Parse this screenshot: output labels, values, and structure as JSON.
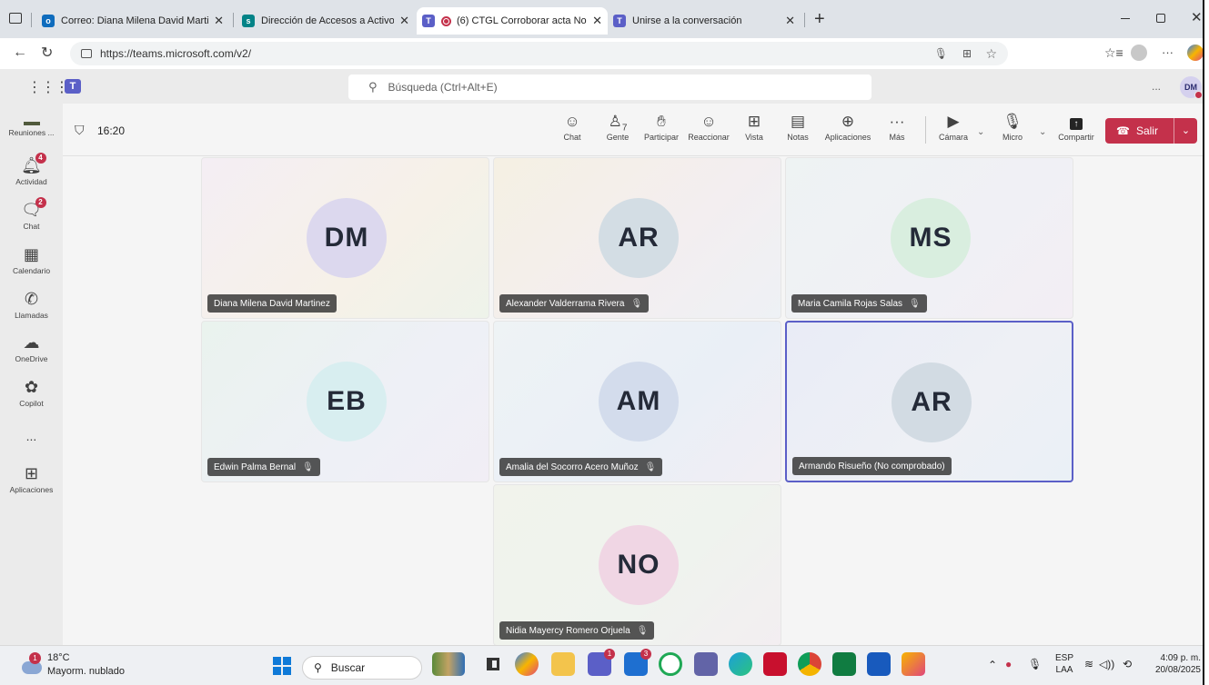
{
  "browser": {
    "tabs": [
      {
        "title": "Correo: Diana Milena David Marti",
        "icon_color": "#0f6cbd",
        "active": false
      },
      {
        "title": "Dirección de Accesos a Activos P",
        "icon_color": "#038387",
        "active": false
      },
      {
        "title": "(6) CTGL Corroborar acta No",
        "icon_color": "#5b5fc7",
        "active": true
      },
      {
        "title": "Unirse a la conversación",
        "icon_color": "#5b5fc7",
        "active": false
      }
    ],
    "url": "https://teams.microsoft.com/v2/",
    "new_tab": "+",
    "profile_initials": "DM"
  },
  "teams": {
    "search_placeholder": "Búsqueda (Ctrl+Alt+E)",
    "profile_initials": "DM",
    "more": "..."
  },
  "rail": [
    {
      "label": "Reuniones ...",
      "icon": "meetings-icon",
      "badge": ""
    },
    {
      "label": "Actividad",
      "icon": "bell-icon",
      "badge": "4"
    },
    {
      "label": "Chat",
      "icon": "chat-icon",
      "badge": "2"
    },
    {
      "label": "Calendario",
      "icon": "calendar-icon",
      "badge": ""
    },
    {
      "label": "Llamadas",
      "icon": "phone-icon",
      "badge": ""
    },
    {
      "label": "OneDrive",
      "icon": "cloud-icon",
      "badge": ""
    },
    {
      "label": "Copilot",
      "icon": "copilot-icon",
      "badge": ""
    },
    {
      "label": "...",
      "icon": "more-icon",
      "badge": ""
    },
    {
      "label": "Aplicaciones",
      "icon": "apps-icon",
      "badge": ""
    }
  ],
  "meeting": {
    "timer": "16:20",
    "people_count": "7",
    "toolbar": {
      "chat": "Chat",
      "people": "Gente",
      "raise": "Participar",
      "react": "Reaccionar",
      "view": "Vista",
      "notes": "Notas",
      "apps": "Aplicaciones",
      "more": "Más",
      "camera": "Cámara",
      "mic": "Micro",
      "share": "Compartir"
    },
    "leave": "Salir",
    "participants": [
      {
        "initials": "DM",
        "name": "Diana Milena David Martinez",
        "muted": false,
        "avatar_color": "#dcd8ee",
        "tile_bg": "linear-gradient(135deg,#f4eef4,#f6f1e8 60%,#eef3ea)"
      },
      {
        "initials": "AR",
        "name": "Alexander Valderrama Rivera",
        "muted": true,
        "avatar_color": "#d3dde4",
        "tile_bg": "linear-gradient(135deg,#f5f0e3,#f3eef0 60%,#eef1f5)"
      },
      {
        "initials": "MS",
        "name": "Maria Camila Rojas Salas",
        "muted": true,
        "avatar_color": "#d9eedf",
        "tile_bg": "linear-gradient(135deg,#eef3f3,#f0f0f5 60%,#f3eef4)"
      },
      {
        "initials": "EB",
        "name": "Edwin Palma Bernal",
        "muted": true,
        "avatar_color": "#d8eef0",
        "tile_bg": "linear-gradient(135deg,#eaf3ee,#eef0f6 60%,#f1eef5)"
      },
      {
        "initials": "AM",
        "name": "Amalia del Socorro Acero Muñoz",
        "muted": true,
        "avatar_color": "#d3dcec",
        "tile_bg": "linear-gradient(135deg,#eef3f5,#eaeff6 60%,#f1eef4)"
      },
      {
        "initials": "AR",
        "name": "Armando Risueño (No comprobado)",
        "muted": false,
        "avatar_color": "#d2dbe3",
        "tile_bg": "linear-gradient(135deg,#e9ecf6,#eef0f5 60%,#eaf0f6)"
      },
      {
        "initials": "NO",
        "name": "Nidia Mayercy Romero Orjuela",
        "muted": true,
        "avatar_color": "#f0d6e4",
        "tile_bg": "linear-gradient(135deg,#f1f3ec,#eff3ee 60%,#f3eef1)"
      }
    ]
  },
  "taskbar": {
    "weather_temp": "18°C",
    "weather_desc": "Mayorm. nublado",
    "weather_badge": "1",
    "search": "Buscar",
    "lang": "ESP",
    "lang2": "LAA",
    "time": "4:09 p. m.",
    "date": "20/08/2025",
    "app_badges": [
      "1",
      "3"
    ]
  }
}
